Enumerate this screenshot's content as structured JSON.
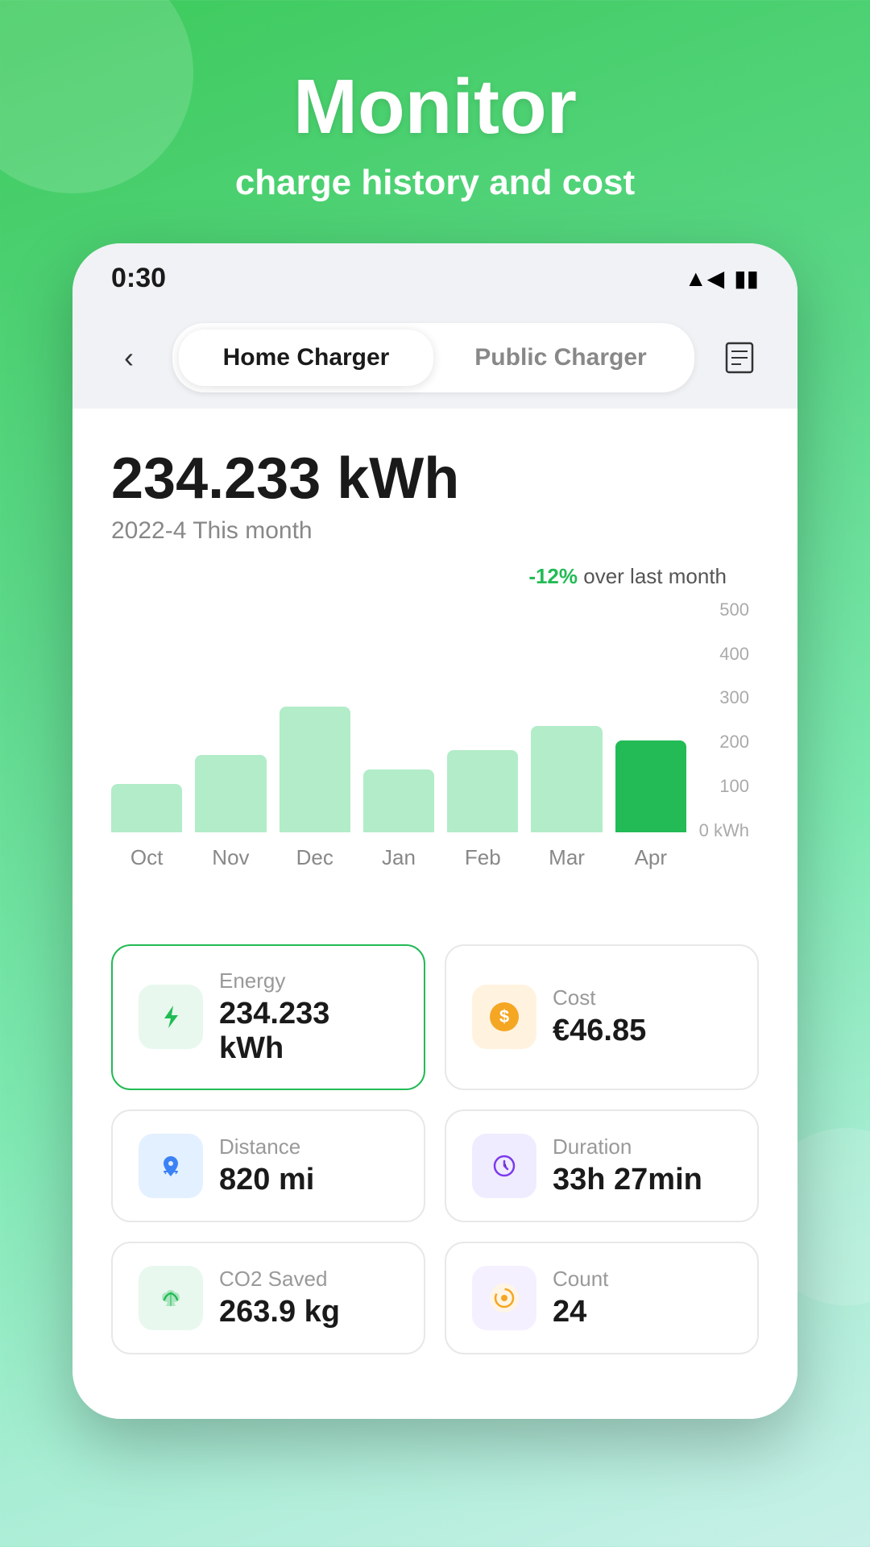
{
  "background": {
    "gradient_start": "#3dca5c",
    "gradient_end": "#c8f0e8"
  },
  "header": {
    "title": "Monitor",
    "subtitle": "charge history and cost"
  },
  "status_bar": {
    "time": "0:30",
    "signal": "▲",
    "battery": "🔋"
  },
  "nav": {
    "back_label": "‹",
    "tab_home": "Home Charger",
    "tab_public": "Public Charger",
    "receipt_icon": "🧾"
  },
  "energy": {
    "value": "234.233 kWh",
    "year_month": "2022-4",
    "period_label": "This month"
  },
  "chart": {
    "comparison_pct": "-12%",
    "comparison_text": "over last month",
    "y_labels": [
      "500",
      "400",
      "300",
      "200",
      "100",
      "0 kWh"
    ],
    "bars": [
      {
        "label": "Oct",
        "height_pct": 20,
        "active": false
      },
      {
        "label": "Nov",
        "height_pct": 32,
        "active": false
      },
      {
        "label": "Dec",
        "height_pct": 52,
        "active": false
      },
      {
        "label": "Jan",
        "height_pct": 26,
        "active": false
      },
      {
        "label": "Feb",
        "height_pct": 34,
        "active": false
      },
      {
        "label": "Mar",
        "height_pct": 44,
        "active": false
      },
      {
        "label": "Apr",
        "height_pct": 38,
        "active": true
      }
    ]
  },
  "stats": [
    {
      "id": "energy",
      "label": "Energy",
      "value": "234.233 kWh",
      "icon": "⚡",
      "icon_class": "icon-green",
      "highlighted": true
    },
    {
      "id": "cost",
      "label": "Cost",
      "value": "€46.85",
      "icon": "$",
      "icon_class": "icon-orange",
      "highlighted": false
    },
    {
      "id": "distance",
      "label": "Distance",
      "value": "820 mi",
      "icon": "📍",
      "icon_class": "icon-blue",
      "highlighted": false
    },
    {
      "id": "duration",
      "label": "Duration",
      "value": "33h 27min",
      "icon": "🕐",
      "icon_class": "icon-purple",
      "highlighted": false
    },
    {
      "id": "co2",
      "label": "CO2 Saved",
      "value": "263.9 kg",
      "icon": "🌿",
      "icon_class": "icon-leaf",
      "highlighted": false
    },
    {
      "id": "count",
      "label": "Count",
      "value": "24",
      "icon": "⏱",
      "icon_class": "icon-clock",
      "highlighted": false
    }
  ]
}
